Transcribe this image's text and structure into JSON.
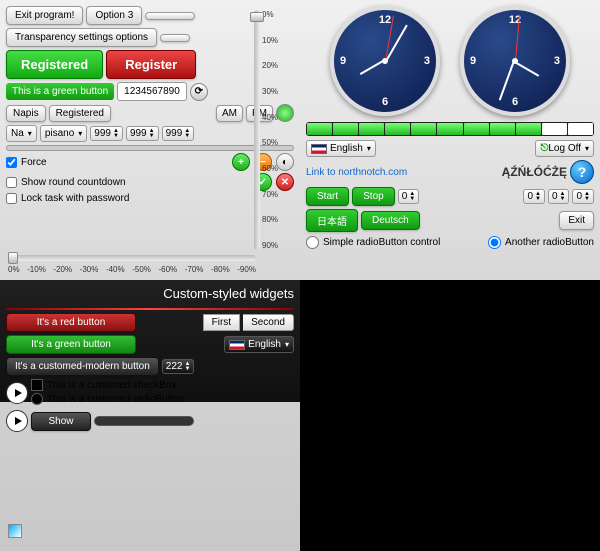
{
  "panel1": {
    "exit_btn": "Exit program!",
    "option3_btn": "Option 3",
    "transparency_btn": "Transparency settings options",
    "registered_btn": "Registered",
    "register_btn": "Register",
    "green_btn_text": "This is a green button",
    "number_display": "1234567890",
    "napis_label": "Napis",
    "registered_label": "Registered",
    "am_label": "AM",
    "pm_label": "PM",
    "combo_na": "Na",
    "combo_pisano": "pisano",
    "spin1": "999",
    "spin2": "999",
    "spin3": "999",
    "force_check": "Force",
    "show_round_check": "Show round countdown",
    "lock_task_check": "Lock task with password",
    "vslider_ticks": [
      "0%",
      "10%",
      "20%",
      "30%",
      "40%",
      "50%",
      "60%",
      "70%",
      "80%",
      "90%"
    ],
    "hslider_ticks": [
      "0%",
      "-10%",
      "-20%",
      "-30%",
      "-40%",
      "-50%",
      "-60%",
      "-70%",
      "-80%",
      "-90%"
    ]
  },
  "panel2": {
    "lang_combo": "English",
    "logoff_combo": "Log Off",
    "link_text": "Link to northnotch.com",
    "special_chars": "ĄŹŃŁÓĆŻĘ",
    "start_btn": "Start",
    "stop_btn": "Stop",
    "jp_btn": "日本語",
    "de_btn": "Deutsch",
    "exit_btn": "Exit",
    "radio1": "Simple radioButton control",
    "radio2": "Another radioButton",
    "spin_vals": [
      "0",
      "0",
      "0",
      "0"
    ]
  },
  "panel3": {
    "title": "Custom-styled widgets",
    "tab1": "First",
    "tab2": "Second",
    "red_btn": "It's a red button",
    "green_btn": "It's a green button",
    "lang_combo": "English",
    "modern_btn": "It's a customed-modern button",
    "spin_val": "222",
    "custom_check": "This is a customed checkBox",
    "custom_radio": "This is a customed radioButton",
    "show_btn": "Show"
  }
}
